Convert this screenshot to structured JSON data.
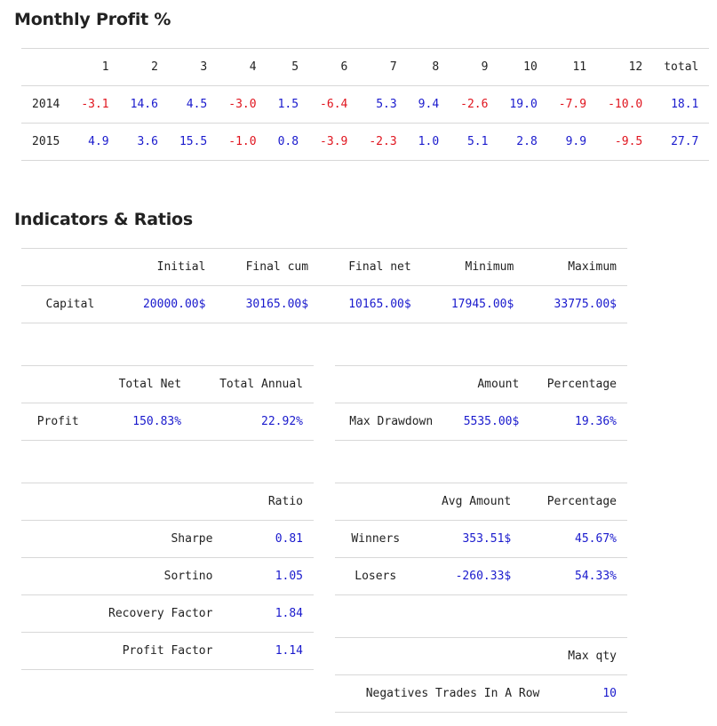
{
  "monthly": {
    "title": "Monthly Profit %",
    "headers": [
      "1",
      "2",
      "3",
      "4",
      "5",
      "6",
      "7",
      "8",
      "9",
      "10",
      "11",
      "12",
      "total"
    ],
    "rows": [
      {
        "year": "2014",
        "values": [
          "-3.1",
          "14.6",
          "4.5",
          "-3.0",
          "1.5",
          "-6.4",
          "5.3",
          "9.4",
          "-2.6",
          "19.0",
          "-7.9",
          "-10.0",
          "18.1"
        ]
      },
      {
        "year": "2015",
        "values": [
          "4.9",
          "3.6",
          "15.5",
          "-1.0",
          "0.8",
          "-3.9",
          "-2.3",
          "1.0",
          "5.1",
          "2.8",
          "9.9",
          "-9.5",
          "27.7"
        ]
      }
    ],
    "colors": {
      "positive": "#1a1acd",
      "negative": "#e0141e"
    }
  },
  "indicators": {
    "title": "Indicators & Ratios",
    "capital": {
      "headers": [
        "Initial",
        "Final cum",
        "Final net",
        "Minimum",
        "Maximum"
      ],
      "label": "Capital",
      "values": [
        "20000.00$",
        "30165.00$",
        "10165.00$",
        "17945.00$",
        "33775.00$"
      ]
    },
    "profit": {
      "headers": [
        "Total Net",
        "Total Annual"
      ],
      "label": "Profit",
      "values": [
        "150.83%",
        "22.92%"
      ]
    },
    "drawdown": {
      "headers": [
        "Amount",
        "Percentage"
      ],
      "label": "Max Drawdown",
      "values": [
        "5535.00$",
        "19.36%"
      ]
    },
    "ratios": {
      "header": "Ratio",
      "rows": [
        {
          "label": "Sharpe",
          "value": "0.81"
        },
        {
          "label": "Sortino",
          "value": "1.05"
        },
        {
          "label": "Recovery Factor",
          "value": "1.84"
        },
        {
          "label": "Profit Factor",
          "value": "1.14"
        }
      ]
    },
    "trades": {
      "headers": [
        "Avg Amount",
        "Percentage"
      ],
      "rows": [
        {
          "label": "Winners",
          "amount": "353.51$",
          "pct": "45.67%"
        },
        {
          "label": "Losers",
          "amount": "-260.33$",
          "pct": "54.33%"
        }
      ]
    },
    "negatives": {
      "header": "Max qty",
      "label": "Negatives Trades In A Row",
      "value": "10"
    }
  }
}
